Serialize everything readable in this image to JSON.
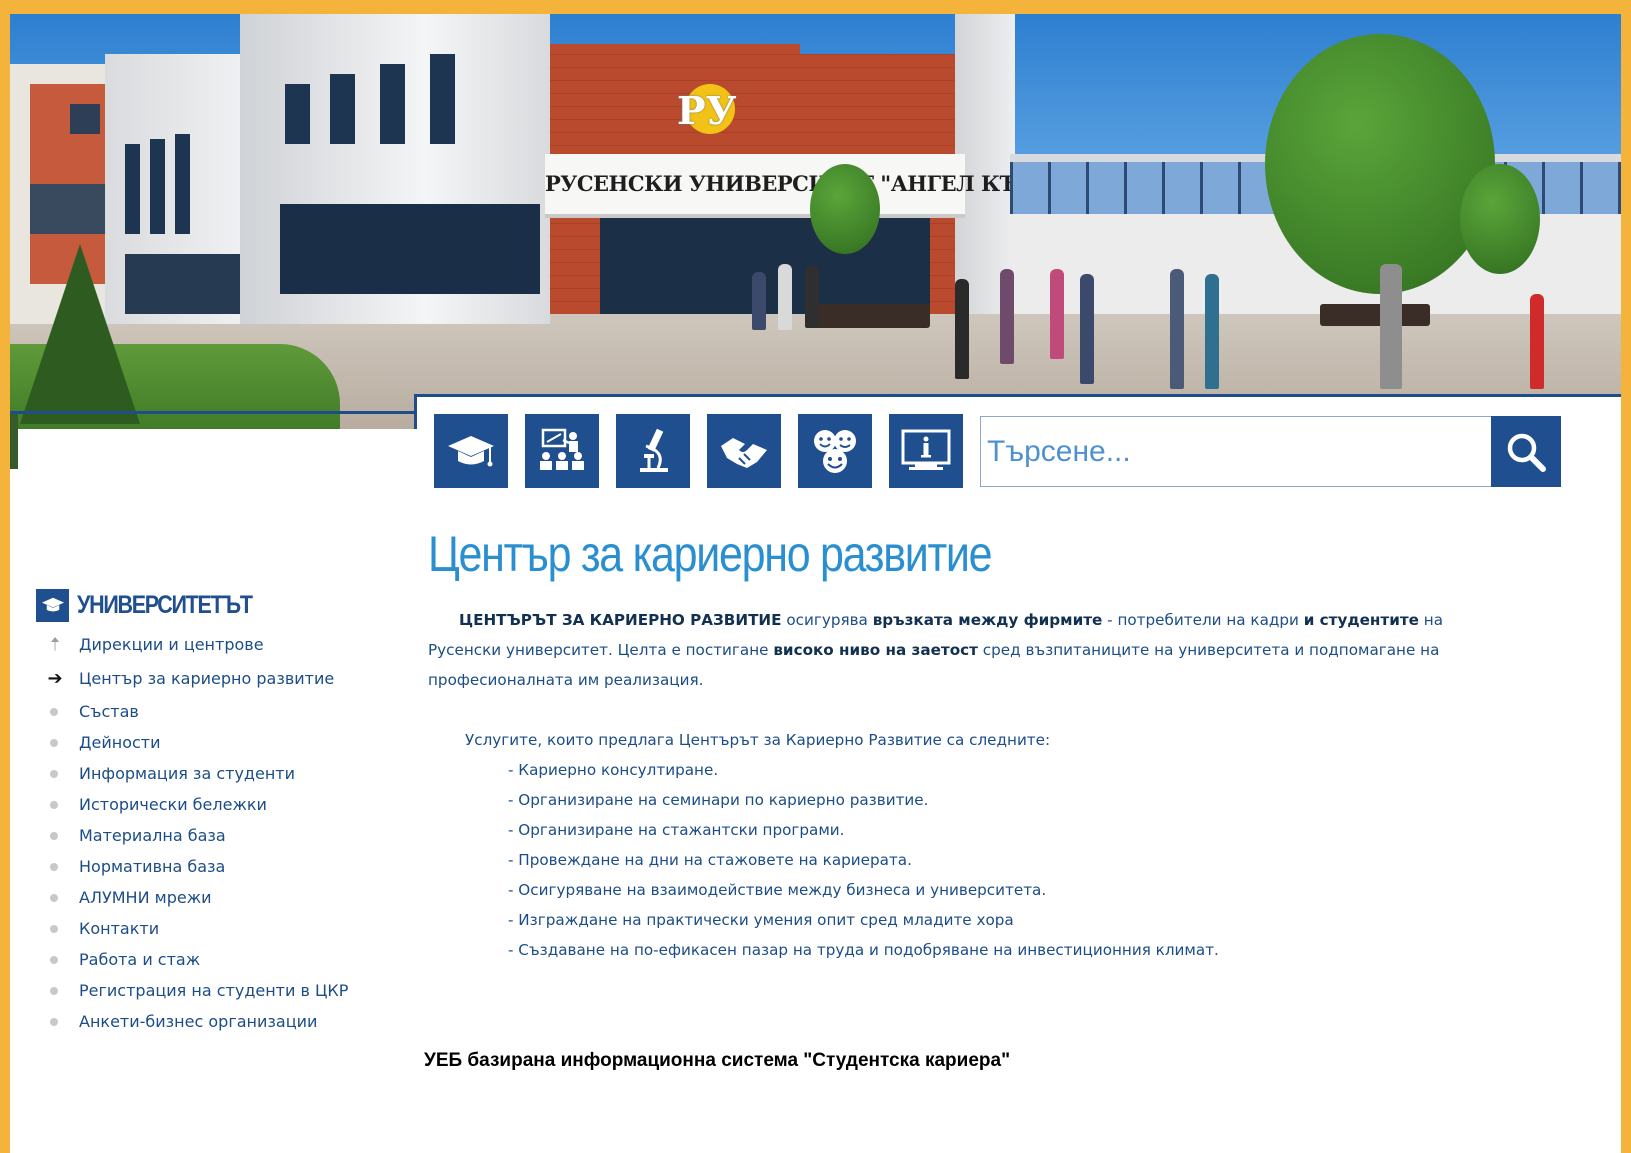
{
  "hero": {
    "sign_text": "РУСЕНСКИ УНИВЕРСИТЕТ \"АНГЕЛ КЪНЧЕВ\"",
    "logo_text": "РУ"
  },
  "icon_bar": [
    {
      "name": "graduation-cap-icon"
    },
    {
      "name": "lecture-icon"
    },
    {
      "name": "microscope-icon"
    },
    {
      "name": "handshake-icon"
    },
    {
      "name": "smileys-icon"
    },
    {
      "name": "info-screen-icon"
    }
  ],
  "search": {
    "placeholder": "Търсене...",
    "icon": "search-icon"
  },
  "sidebar": {
    "title": "УНИВЕРСИТЕТЪТ",
    "items": [
      {
        "label": "Дирекции и центрове",
        "marker": "arrow-up"
      },
      {
        "label": "Център за кариерно развитие",
        "marker": "arrow-right"
      },
      {
        "label": "Състав",
        "marker": "bullet"
      },
      {
        "label": "Дейности",
        "marker": "bullet"
      },
      {
        "label": "Информация за студенти",
        "marker": "bullet"
      },
      {
        "label": "Исторически бележки",
        "marker": "bullet"
      },
      {
        "label": "Материална база",
        "marker": "bullet"
      },
      {
        "label": "Нормативна база",
        "marker": "bullet"
      },
      {
        "label": "АЛУМНИ мрежи",
        "marker": "bullet"
      },
      {
        "label": "Контакти",
        "marker": "bullet"
      },
      {
        "label": "Работа и стаж",
        "marker": "bullet"
      },
      {
        "label": "Регистрация на студенти в ЦКР",
        "marker": "bullet"
      },
      {
        "label": "Анкети-бизнес организации",
        "marker": "bullet"
      }
    ]
  },
  "main": {
    "title": "Център за кариерно развитие",
    "intro": {
      "p1": "ЦЕНТЪРЪТ ЗА КАРИЕРНО РАЗВИТИЕ",
      "p2": " осигурява ",
      "p3": "връзката между фирмите",
      "p4": " - потребители на кадри ",
      "p5": "и студентите",
      "p6": " на Русенски университет. Целта е постигане ",
      "p7": "високо ниво на заетост",
      "p8": " сред възпитаниците на университета и подпомагане на професионалната им реализация."
    },
    "services_heading": "Услугите, които предлага Центърът за Кариерно Развитие са следните:",
    "services": [
      "- Кариерно консултиране.",
      "- Организиране на семинари по кариерно развитие.",
      "- Организиране на стажантски програми.",
      "- Провеждане на дни на стажовете на кариерата.",
      "- Осигуряване на взаимодействие между бизнеса и университета.",
      "- Изграждане на практически умения опит сред младите хора",
      "- Създаване на по-ефикасен пазар на труда и подобряване на инвестиционния климат."
    ],
    "footer_title": "УЕБ базирана информационна система \"Студентска кариера\""
  },
  "colors": {
    "frame": "#f4b33a",
    "brand_blue": "#1f4f8e",
    "title_blue": "#2a8fd0",
    "text_blue": "#1c4d86"
  }
}
